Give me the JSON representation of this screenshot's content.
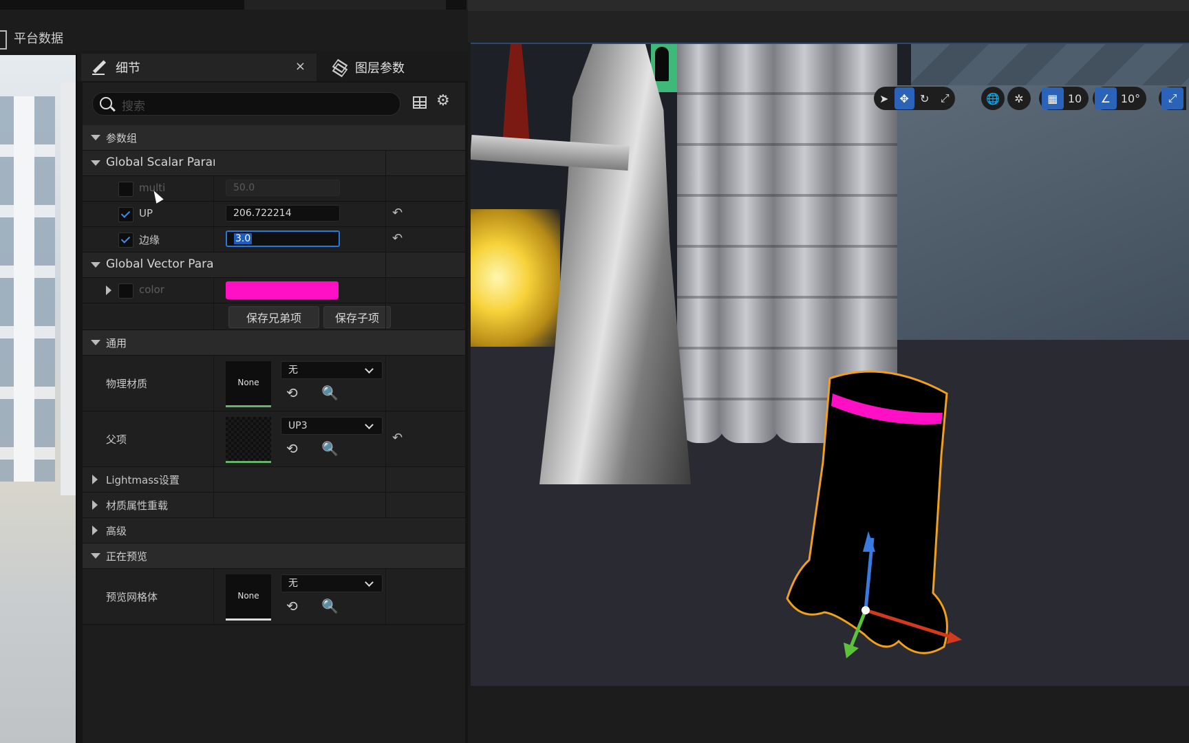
{
  "window": {
    "title": "平台数据"
  },
  "panel": {
    "tabs": [
      {
        "label": "细节",
        "icon": "pencil-icon",
        "active": true
      },
      {
        "label": "图层参数",
        "icon": "layers-icon",
        "active": false
      }
    ],
    "close_glyph": "×",
    "search": {
      "placeholder": "搜索",
      "value": ""
    },
    "categories": {
      "param_group": "参数组",
      "global_scalar": "Global Scalar Param",
      "global_vector": "Global Vector Param",
      "general": "通用",
      "lightmass": "Lightmass设置",
      "material_override": "材质属性重载",
      "advanced": "高级",
      "previewing": "正在预览"
    },
    "scalar_params": [
      {
        "name": "multi",
        "value": "50.0",
        "enabled": false
      },
      {
        "name": "UP",
        "value": "206.722214",
        "enabled": true
      },
      {
        "name": "边缘",
        "value": "3.0",
        "enabled": true,
        "focused": true
      }
    ],
    "vector_params": [
      {
        "name": "color",
        "color": "#ff10c4",
        "enabled": false
      }
    ],
    "buttons": {
      "save_siblings": "保存兄弟项",
      "save_children": "保存子项"
    },
    "general": {
      "phys_material": {
        "label": "物理材质",
        "thumb": "None",
        "dropdown": "无"
      },
      "parent": {
        "label": "父项",
        "dropdown": "UP3"
      }
    },
    "preview": {
      "label": "预览网格体",
      "thumb": "None",
      "dropdown": "无"
    },
    "reset_glyph": "↶",
    "asset_icons": "⟲ 🔍"
  },
  "viewport": {
    "toolbar": {
      "grid_snap": "10",
      "angle_snap": "10°"
    },
    "colors": {
      "accent": "#2a63b8",
      "selection": "#f0a020",
      "emissive": "#ff10c4"
    }
  }
}
